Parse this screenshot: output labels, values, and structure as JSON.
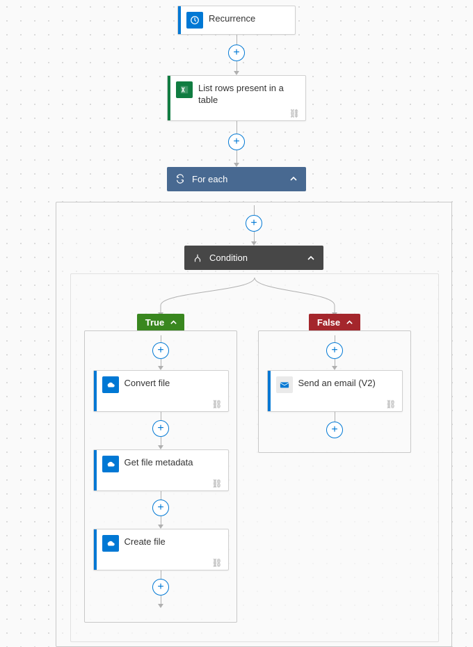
{
  "actions": {
    "recurrence": {
      "label": "Recurrence",
      "accent": "#0078d4",
      "icon_bg": "#0078d4"
    },
    "list_rows": {
      "label": "List rows present in a table",
      "accent": "#107c41",
      "icon_bg": "#107c41"
    },
    "for_each": {
      "label": "For each",
      "bg": "#486991"
    },
    "condition": {
      "label": "Condition",
      "bg": "#474747"
    },
    "true_branch": {
      "label": "True",
      "bg": "#39871f"
    },
    "false_branch": {
      "label": "False",
      "bg": "#a4262c"
    },
    "convert_file": {
      "label": "Convert file",
      "accent": "#0078d4",
      "icon_bg": "#0078d4"
    },
    "get_metadata": {
      "label": "Get file metadata",
      "accent": "#0078d4",
      "icon_bg": "#0078d4"
    },
    "create_file": {
      "label": "Create file",
      "accent": "#0078d4",
      "icon_bg": "#0078d4"
    },
    "send_email": {
      "label": "Send an email (V2)",
      "accent": "#0078d4",
      "icon_bg": "#0078d4"
    }
  }
}
